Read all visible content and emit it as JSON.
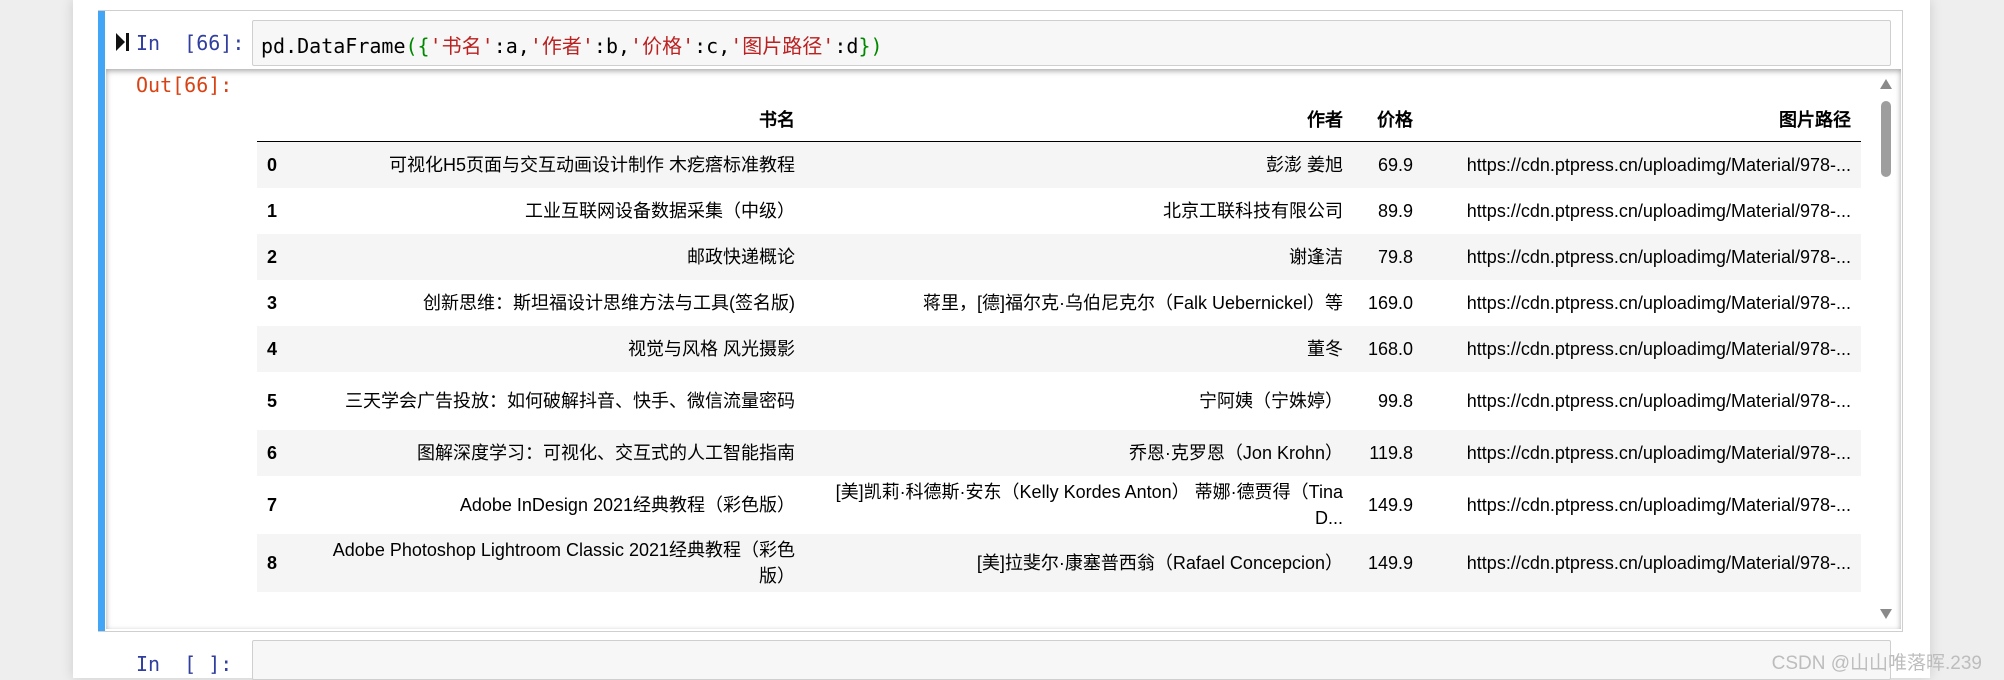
{
  "cell": {
    "in_prompt": "In  [66]:",
    "out_prompt": "Out[66]:",
    "code": {
      "fn": "pd.DataFrame",
      "open": "({",
      "k1": "'书名'",
      "v1": ":a,",
      "k2": "'作者'",
      "v2": ":b,",
      "k3": "'价格'",
      "v3": ":c,",
      "k4": "'图片路径'",
      "v4": ":d",
      "close": "})"
    }
  },
  "table": {
    "columns": [
      "书名",
      "作者",
      "价格",
      "图片路径"
    ],
    "rows": [
      {
        "index": "0",
        "title": "可视化H5页面与交互动画设计制作 木疙瘩标准教程",
        "author": "彭澎 姜旭",
        "price": "69.9",
        "path": "https://cdn.ptpress.cn/uploadimg/Material/978-..."
      },
      {
        "index": "1",
        "title": "工业互联网设备数据采集（中级）",
        "author": "北京工联科技有限公司",
        "price": "89.9",
        "path": "https://cdn.ptpress.cn/uploadimg/Material/978-..."
      },
      {
        "index": "2",
        "title": "邮政快递概论",
        "author": "谢逢洁",
        "price": "79.8",
        "path": "https://cdn.ptpress.cn/uploadimg/Material/978-..."
      },
      {
        "index": "3",
        "title": "创新思维：斯坦福设计思维方法与工具(签名版)",
        "author": "蒋里，[德]福尔克·乌伯尼克尔（Falk Uebernickel）等",
        "price": "169.0",
        "path": "https://cdn.ptpress.cn/uploadimg/Material/978-..."
      },
      {
        "index": "4",
        "title": "视觉与风格 风光摄影",
        "author": "董冬",
        "price": "168.0",
        "path": "https://cdn.ptpress.cn/uploadimg/Material/978-..."
      },
      {
        "index": "5",
        "title": "三天学会广告投放：如何破解抖音、快手、微信流量密码",
        "author": "宁阿姨（宁姝婷）",
        "price": "99.8",
        "path": "https://cdn.ptpress.cn/uploadimg/Material/978-..."
      },
      {
        "index": "6",
        "title": "图解深度学习：可视化、交互式的人工智能指南",
        "author": "乔恩·克罗恩（Jon Krohn）",
        "price": "119.8",
        "path": "https://cdn.ptpress.cn/uploadimg/Material/978-..."
      },
      {
        "index": "7",
        "title": "Adobe InDesign 2021经典教程（彩色版）",
        "author": "[美]凯莉·科德斯·安东（Kelly Kordes Anton） 蒂娜·德贾得（Tina D...",
        "price": "149.9",
        "path": "https://cdn.ptpress.cn/uploadimg/Material/978-..."
      },
      {
        "index": "8",
        "title": "Adobe Photoshop Lightroom Classic 2021经典教程（彩色版）",
        "author": "[美]拉斐尔·康塞普西翁（Rafael Concepcion）",
        "price": "149.9",
        "path": "https://cdn.ptpress.cn/uploadimg/Material/978-..."
      }
    ]
  },
  "next_cell": {
    "in_prompt": "In  [ ]:"
  },
  "watermark": "CSDN @山山唯落晖.239",
  "icons": {
    "run": "run-cell-icon",
    "scroll_up": "scroll-up-icon",
    "scroll_down": "scroll-down-icon"
  },
  "colors": {
    "selected_bar": "#42a5f5",
    "in_prompt": "#303f9f",
    "out_prompt": "#d84315",
    "string": "#ba2121",
    "paren": "#008800"
  }
}
